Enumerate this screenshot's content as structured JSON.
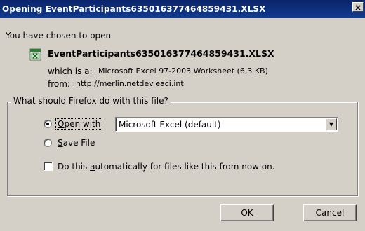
{
  "window": {
    "title": "Opening EventParticipants635016377464859431.XLSX",
    "close_glyph": "×"
  },
  "dialog": {
    "intro": "You have chosen to open",
    "file_icon": "excel-file-icon",
    "filename": "EventParticipants635016377464859431.XLSX",
    "which_label": "which is a:",
    "which_value": "Microsoft Excel 97-2003 Worksheet (6,3 KB)",
    "from_label": "from:",
    "from_value": "http://merlin.netdev.eaci.int"
  },
  "group": {
    "legend": "What should Firefox do with this file?",
    "open_with": {
      "label_mnemonic": "O",
      "label_rest": "pen with",
      "selected": true
    },
    "open_with_app": "Microsoft Excel (default)",
    "save_file": {
      "label_mnemonic": "S",
      "label_rest": "ave File",
      "selected": false
    },
    "auto": {
      "label_pre": "Do this ",
      "label_mnemonic": "a",
      "label_rest": "utomatically for files like this from now on.",
      "checked": false
    }
  },
  "buttons": {
    "ok": "OK",
    "cancel": "Cancel"
  }
}
